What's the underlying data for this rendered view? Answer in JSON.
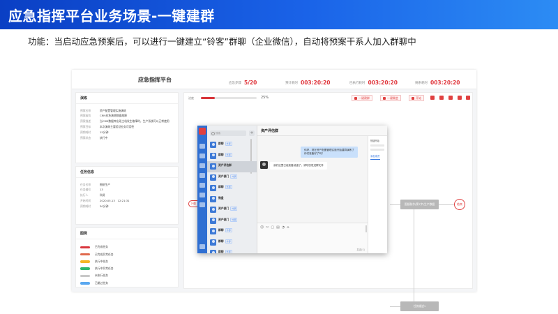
{
  "slide": {
    "title": "应急指挥平台业务场景-一键建群",
    "description": "功能：当启动应急预案后，可以进行一键建立“铃客”群聊（企业微信），自动将预案干系人加入群聊中"
  },
  "app": {
    "title": "应急指挥平台",
    "stats": [
      {
        "label": "应急步骤",
        "value": "5/20"
      },
      {
        "label": "预计耗时",
        "value": "003:20:20"
      },
      {
        "label": "已执行耗时",
        "value": "003:20:20"
      },
      {
        "label": "剩余耗时",
        "value": "003:20:20"
      }
    ]
  },
  "plan_panel": {
    "header": "演练",
    "rows": [
      {
        "k": "预案名称",
        "v": "资产配置管理实施演练"
      },
      {
        "k": "预案级别",
        "v": "CRM应急演练数据故障"
      },
      {
        "k": "预案描述",
        "v": "当CRM数据库出现主机发生故障时，生产系统可以正常使用"
      },
      {
        "k": "预案目标",
        "v": "本次演练主要验证业务可用性"
      },
      {
        "k": "预期耗时",
        "v": "15分钟"
      },
      {
        "k": "预案状态",
        "v": "执行中"
      }
    ]
  },
  "task_panel": {
    "header": "任务信息",
    "rows": [
      {
        "k": "任务名称",
        "v": "图纸生产"
      },
      {
        "k": "任务编号",
        "v": "13"
      },
      {
        "k": "执行人",
        "v": "科贤"
      },
      {
        "k": "开始时间",
        "v": "2020.05.13　12:21:31"
      },
      {
        "k": "预期耗时",
        "v": "30分钟"
      }
    ]
  },
  "legend_panel": {
    "header": "图例",
    "items": [
      {
        "label": "已完成任务",
        "color": "#d9363e"
      },
      {
        "label": "已完成异常任务",
        "color": "#e06a4e"
      },
      {
        "label": "执行中任务",
        "color": "#f5b625"
      },
      {
        "label": "执行中异常任务",
        "color": "#2fb86d"
      },
      {
        "label": "未执行任务",
        "color": "#c8c8c8"
      },
      {
        "label": "已跳过任务",
        "color": "#5aa8f0"
      }
    ]
  },
  "main": {
    "progress_label": "进度",
    "progress_value": 0.25,
    "progress_text": "25%",
    "toolbar": {
      "group_btn": "一键建群",
      "meeting_btn": "一键開会",
      "start_btn": "开始"
    }
  },
  "flow": {
    "start_tab": "下载",
    "node_top": "图纸制作(第7步)生产数据",
    "end_label": "结束",
    "node_bottom": "任务描述1"
  },
  "wecom": {
    "search_placeholder": "搜索",
    "chats": [
      {
        "name": "群聊",
        "tag": "外部",
        "preview": "",
        "time": ""
      },
      {
        "name": "群聊",
        "tag": "外部",
        "preview": "",
        "time": ""
      },
      {
        "name": "资产评估群",
        "tag": "",
        "preview": "",
        "time": ""
      },
      {
        "name": "资产部门",
        "tag": "外部",
        "preview": "",
        "time": ""
      },
      {
        "name": "群聊",
        "tag": "外部",
        "preview": "",
        "time": ""
      },
      {
        "name": "微盘",
        "tag": "",
        "preview": "",
        "time": ""
      },
      {
        "name": "资产部门",
        "tag": "外部",
        "preview": "",
        "time": ""
      },
      {
        "name": "资产部门",
        "tag": "外部",
        "preview": "",
        "time": ""
      },
      {
        "name": "群聊",
        "tag": "外部",
        "preview": "",
        "time": ""
      },
      {
        "name": "群聊",
        "tag": "外部",
        "preview": "",
        "time": ""
      },
      {
        "name": "群聊",
        "tag": "外部",
        "preview": "",
        "time": ""
      }
    ],
    "chat_title": "资产评估群",
    "msg_right": [
      "你好，现在资产配置管理实施开始建群演练了",
      "你们准备好了吗？"
    ],
    "msg_left": "我们这里已经准备就绪了，请尽快发送群文件",
    "members_title": "快捷开始",
    "members_link": "添加成员",
    "send_label": "发送(S)"
  }
}
